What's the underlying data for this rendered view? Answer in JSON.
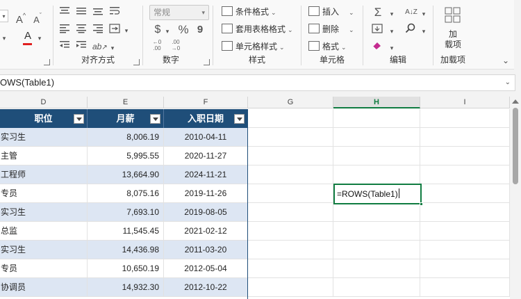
{
  "ribbon": {
    "font_group": {
      "increase_font_icon": "A^",
      "decrease_font_icon": "Av",
      "font_color_glyph": "A"
    },
    "alignment_group": {
      "label": "对齐方式"
    },
    "number_group": {
      "label": "数字",
      "format_value": "常规",
      "currency_glyph": "$",
      "percent_glyph": "%",
      "comma_glyph": "9"
    },
    "styles_group": {
      "label": "样式",
      "conditional_format": "条件格式",
      "format_as_table": "套用表格格式",
      "cell_styles": "单元格样式"
    },
    "cells_group": {
      "label": "单元格",
      "insert": "插入",
      "delete": "删除",
      "format": "格式"
    },
    "editing_group": {
      "label": "编辑",
      "sum_glyph": "Σ",
      "sort_glyph": "A↓Z"
    },
    "addins_group": {
      "label": "加载项",
      "addins_button_line1": "加",
      "addins_button_line2": "载项"
    }
  },
  "formula_bar": {
    "content": "OWS(Table1)"
  },
  "columns": [
    "D",
    "E",
    "F",
    "G",
    "H",
    "I"
  ],
  "active_column": "H",
  "table": {
    "headers": [
      "职位",
      "月薪",
      "入职日期"
    ],
    "rows": [
      [
        "实习生",
        "8,006.19",
        "2010-04-11"
      ],
      [
        "主管",
        "5,995.55",
        "2020-11-27"
      ],
      [
        "工程师",
        "13,664.90",
        "2024-11-21"
      ],
      [
        "专员",
        "8,075.16",
        "2019-11-26"
      ],
      [
        "实习生",
        "7,693.10",
        "2019-08-05"
      ],
      [
        "总监",
        "11,545.45",
        "2021-02-12"
      ],
      [
        "实习生",
        "14,436.98",
        "2011-03-20"
      ],
      [
        "专员",
        "10,650.19",
        "2012-05-04"
      ],
      [
        "协调员",
        "14,932.30",
        "2012-10-22"
      ]
    ]
  },
  "active_cell": {
    "content": "=ROWS(Table1)"
  },
  "colors": {
    "table_header": "#1f4e79",
    "band": "#dde6f3",
    "selection": "#107c41"
  }
}
